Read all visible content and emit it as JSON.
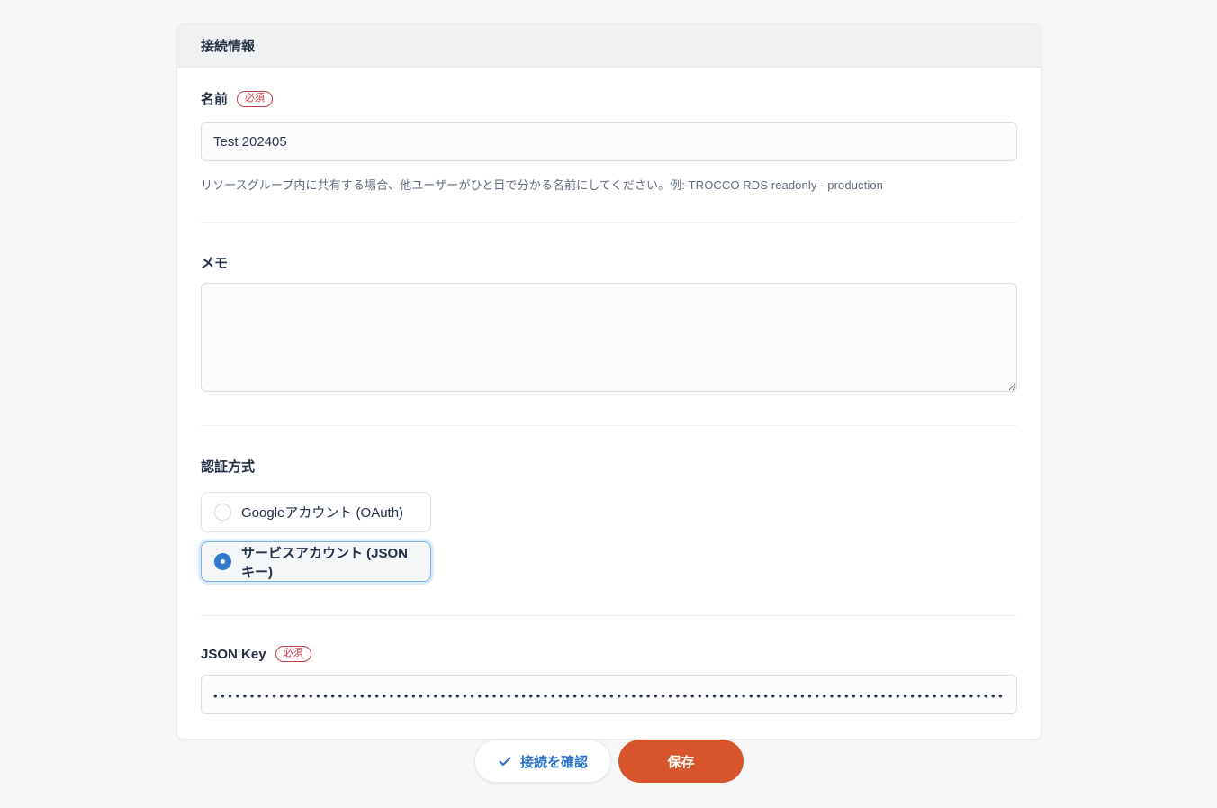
{
  "card": {
    "title": "接続情報"
  },
  "fields": {
    "name": {
      "label": "名前",
      "required_badge": "必須",
      "value": "Test 202405",
      "help": "リソースグループ内に共有する場合、他ユーザーがひと目で分かる名前にしてください。例: TROCCO RDS readonly - production"
    },
    "memo": {
      "label": "メモ",
      "value": ""
    },
    "auth": {
      "label": "認証方式",
      "options": [
        {
          "label": "Googleアカウント (OAuth)",
          "selected": false
        },
        {
          "label": "サービスアカウント (JSONキー)",
          "selected": true
        }
      ]
    },
    "json_key": {
      "label": "JSON Key",
      "required_badge": "必須",
      "masked_value": "••••••••••••••••••••••••••••••••••••••••••••••••••••••••••••••••••••••••••••••••••••••••••••••••••••••••••••••••••••••"
    }
  },
  "actions": {
    "check_connection_label": "接続を確認",
    "save_label": "保存"
  },
  "colors": {
    "accent_blue": "#2b72c7",
    "selected_blue": "#2d79d0",
    "save_orange": "#d8542c",
    "required_red": "#c43a45",
    "page_bg": "#f7f7f8"
  }
}
